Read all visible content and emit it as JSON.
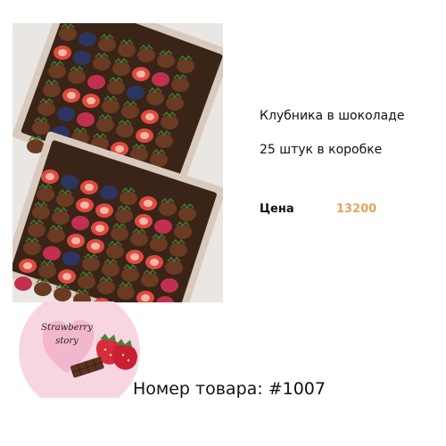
{
  "product": {
    "name": "Клубника в шоколаде",
    "pack_count": "25 штук в коробке",
    "price_label": "Цена",
    "price_value": "13200",
    "article": "Номер товара: #1007"
  },
  "logo": {
    "line1": "Strawberry",
    "line2": "story"
  },
  "colors": {
    "price_accent": "#e0a55f",
    "logo_pink": "#f7d6e2",
    "heart_pink": "#f2b7cd"
  },
  "icons": {
    "logo_strawberries": "strawberry-icon",
    "logo_chocolate": "chocolate-bar-icon",
    "logo_heart": "heart-icon"
  }
}
